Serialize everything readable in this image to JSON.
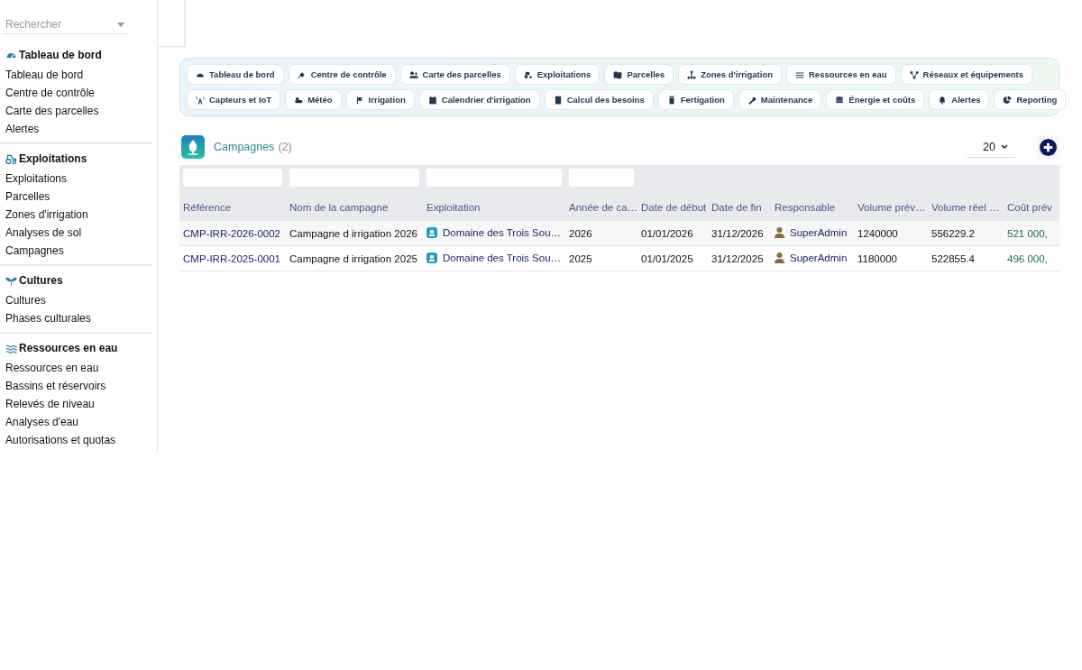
{
  "sidebar": {
    "search": {
      "placeholder": "Rechercher"
    },
    "sections": [
      {
        "title": "Tableau de bord",
        "items": [
          "Tableau de bord",
          "Centre de contrôle",
          "Carte des parcelles",
          "Alertes"
        ]
      },
      {
        "title": "Exploitations",
        "items": [
          "Exploitations",
          "Parcelles",
          "Zones d'irrigation",
          "Analyses de sol",
          "Campagnes"
        ]
      },
      {
        "title": "Cultures",
        "items": [
          "Cultures",
          "Phases culturales"
        ]
      },
      {
        "title": "Ressources en eau",
        "items": [
          "Ressources en eau",
          "Bassins et réservoirs",
          "Relevés de niveau",
          "Analyses d'eau",
          "Autorisations et quotas"
        ]
      }
    ]
  },
  "nav_rows": [
    [
      "Tableau de bord",
      "Centre de contrôle",
      "Carte des parcelles",
      "Exploitations",
      "Parcelles",
      "Zones d'irrigation",
      "Ressources en eau",
      "Réseaux et équipements"
    ],
    [
      "Capteurs et IoT",
      "Météo",
      "Irrigation",
      "Calendrier d'irrigation",
      "Calcul des besoins",
      "Fertigation",
      "Maintenance",
      "Énergie et coûts",
      "Alertes",
      "Reporting"
    ]
  ],
  "list": {
    "title": "Campagnes",
    "count": "(2)",
    "page_size": "20",
    "columns": [
      {
        "label": "Référence",
        "filter": true
      },
      {
        "label": "Nom de la campagne",
        "filter": true
      },
      {
        "label": "Exploitation",
        "filter": true
      },
      {
        "label": "Année de ca…",
        "filter": true
      },
      {
        "label": "Date de début",
        "filter": false
      },
      {
        "label": "Date de fin",
        "filter": false
      },
      {
        "label": "Responsable",
        "filter": false
      },
      {
        "label": "Volume prév…",
        "filter": false
      },
      {
        "label": "Volume réel …",
        "filter": false
      },
      {
        "label": "Coût prév",
        "filter": false
      }
    ],
    "rows": [
      {
        "reference": "CMP-IRR-2026-0002",
        "name": "Campagne d irrigation 2026",
        "exploitation": "Domaine des Trois Sou…",
        "year": "2026",
        "start": "01/01/2026",
        "end": "31/12/2026",
        "responsable": "SuperAdmin",
        "volume_planned": "1240000",
        "volume_actual": "556229.2",
        "cost_planned": "521 000,"
      },
      {
        "reference": "CMP-IRR-2025-0001",
        "name": "Campagne d irrigation 2025",
        "exploitation": "Domaine des Trois Sou…",
        "year": "2025",
        "start": "01/01/2025",
        "end": "31/12/2025",
        "responsable": "SuperAdmin",
        "volume_planned": "1180000",
        "volume_actual": "522855.4",
        "cost_planned": "496 000,"
      }
    ]
  }
}
